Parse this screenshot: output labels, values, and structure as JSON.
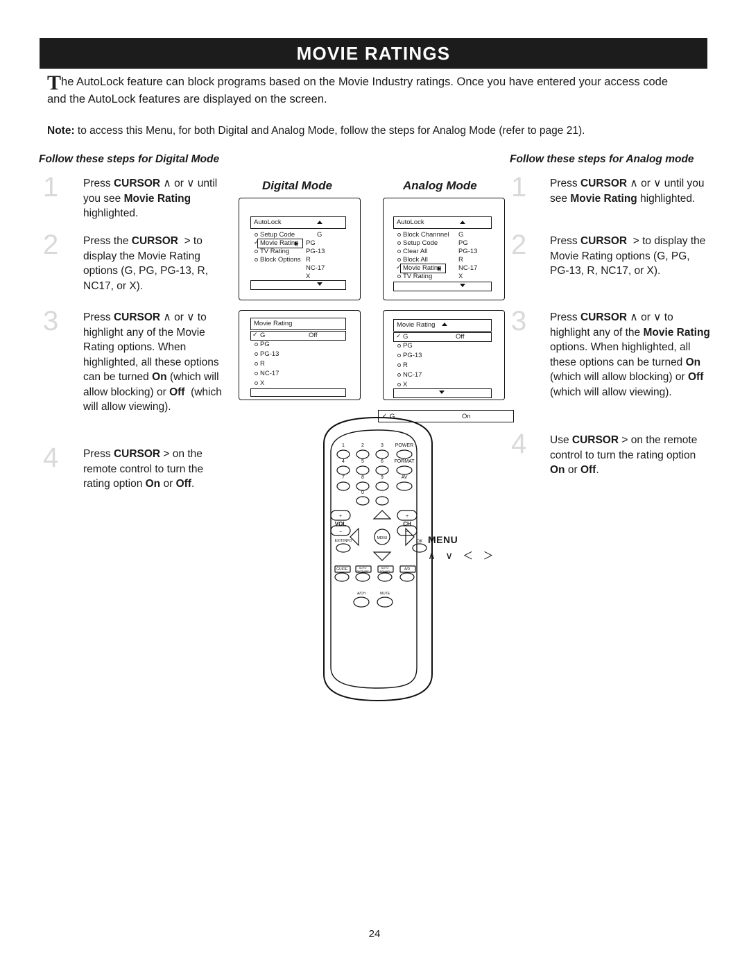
{
  "header": {
    "title": "MOVIE RATINGS"
  },
  "intro": {
    "dropcap": "T",
    "text": "he AutoLock feature can block programs based on the Movie Industry ratings.   Once you have entered your access code and the AutoLock features are displayed on the screen."
  },
  "note": "Note: to access this Menu, for both Digital and Analog Mode, follow the steps for Analog Mode (refer to page 21).",
  "columns": {
    "left_heading": "Follow these steps for Digital Mode",
    "right_heading": "Follow these steps for Analog mode"
  },
  "left_steps": [
    {
      "num": "1",
      "html": "Press <b>CURSOR</b> ∧ or ∨ until you see <b>Movie Rating</b>&nbsp; highlighted."
    },
    {
      "num": "2",
      "html": "Press the <b>CURSOR</b> &nbsp;&gt; to display the Movie Rating options (G, PG, PG-13, R, NC17, or X)."
    },
    {
      "num": "3",
      "html": "Press <b>CURSOR</b> ∧ or ∨ to highlight any of the Movie Rating options. When highlighted, all these options can be turned <b>On</b> (which will allow blocking) or <b>Off</b>&nbsp; (which will allow viewing)."
    },
    {
      "num": "4",
      "html": "Press <b>CURSOR</b> &gt; on the remote control to turn the rating option <b>On</b> or <b>Off</b>."
    }
  ],
  "right_steps": [
    {
      "num": "1",
      "html": "Press <b>CURSOR</b> ∧ or ∨ until you see <b>Movie Rating</b> highlighted."
    },
    {
      "num": "2",
      "html": "Press <b>CURSOR</b> &nbsp;&gt; to display the Movie Rating options (G, PG, PG-13, R, NC17, or X)."
    },
    {
      "num": "3",
      "html": "Press <b>CURSOR</b> ∧ or ∨ to highlight any of the <b>Movie Rating</b> options.  When highlighted, all these options can be turned <b>On</b> (which will allow blocking) or <b>Off</b> (which will allow viewing)."
    },
    {
      "num": "4",
      "html": "Use <b>CURSOR</b> &gt; on the remote control to turn the rating option <b>On</b> or <b>Off</b>."
    }
  ],
  "digital": {
    "title": "Digital Mode",
    "menu1": {
      "header": "AutoLock",
      "rows": [
        {
          "label": "Setup Code",
          "value": "G"
        },
        {
          "label": "Movie Rating",
          "value": "PG",
          "highlighted": true
        },
        {
          "label": "TV Rating",
          "value": "PG-13"
        },
        {
          "label": "Block Options",
          "value": "R"
        },
        {
          "label": "",
          "value": "NC-17"
        },
        {
          "label": "",
          "value": "X"
        }
      ]
    },
    "menu2": {
      "header": "Movie Rating",
      "state": "Off",
      "rows": [
        "G",
        "PG",
        "PG-13",
        "R",
        "NC-17",
        "X"
      ]
    }
  },
  "analog": {
    "title": "Analog Mode",
    "menu1": {
      "header": "AutoLock",
      "rows": [
        {
          "label": "Block Channnel",
          "value": "G"
        },
        {
          "label": "Setup Code",
          "value": "PG"
        },
        {
          "label": "Clear All",
          "value": "PG-13"
        },
        {
          "label": "Block All",
          "value": "R"
        },
        {
          "label": "Movie Rating",
          "value": "NC-17",
          "highlighted": true
        },
        {
          "label": "TV Rating",
          "value": "X"
        }
      ]
    },
    "menu2": {
      "header": "Movie Rating",
      "state": "Off",
      "rows": [
        "G",
        "PG",
        "PG-13",
        "R",
        "NC-17",
        "X"
      ]
    },
    "statusbar": {
      "label": "G",
      "value": "On"
    }
  },
  "remote": {
    "keys_numeric": [
      "1",
      "2",
      "3",
      "4",
      "5",
      "6",
      "7",
      "8",
      "9",
      "0"
    ],
    "keys_right": [
      "POWER",
      "FORMAT",
      "AV"
    ],
    "dot_key": "·",
    "vol_label": "VOL",
    "ch_label": "CH",
    "plus": "+",
    "minus": "−",
    "menu_key": "MENU",
    "exit_info": "EXIT/INFO",
    "ok": "OK",
    "bottom_keys": [
      "GUIDE",
      "AUTO PICTURE",
      "AUTO SOUND",
      "A/D"
    ],
    "bottom_keys2": [
      "A/CH",
      "MUTE"
    ]
  },
  "callout": {
    "menu_label": "MENU",
    "arrows": "∧ ∨ ＜ ＞"
  },
  "page_number": "24"
}
